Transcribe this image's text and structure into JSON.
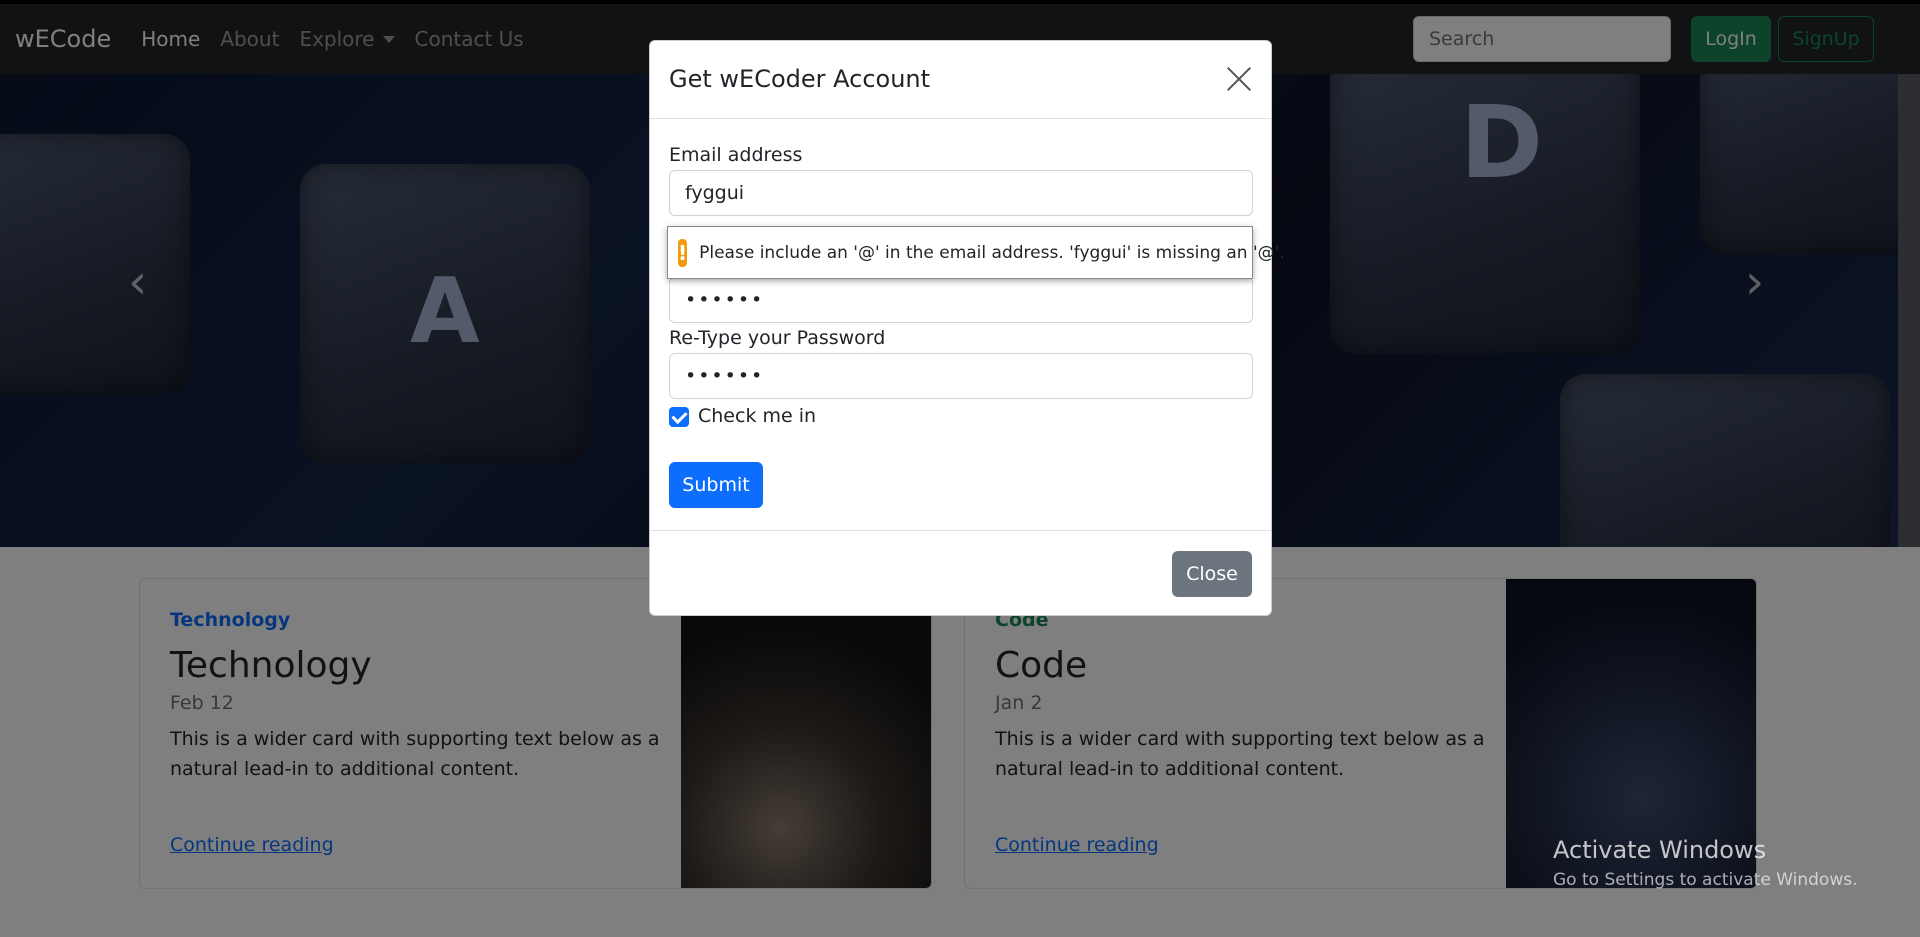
{
  "navbar": {
    "brand": "wECode",
    "links": [
      "Home",
      "About",
      "Explore",
      "Contact Us"
    ],
    "search_placeholder": "Search",
    "login_label": "LogIn",
    "signup_label": "SignUp"
  },
  "hero": {
    "prev_icon": "chevron-left-icon",
    "next_icon": "chevron-right-icon"
  },
  "cards": [
    {
      "category": "Technology",
      "category_color": "#0d6efd",
      "title": "Technology",
      "date": "Feb 12",
      "text": "This is a wider card with supporting text below as a natural lead-in to additional content.",
      "link": "Continue reading"
    },
    {
      "category": "Code",
      "category_color": "#198754",
      "title": "Code",
      "date": "Jan 2",
      "text": "This is a wider card with supporting text below as a natural lead-in to additional content.",
      "link": "Continue reading"
    }
  ],
  "modal": {
    "title": "Get wECoder Account",
    "email_label": "Email address",
    "email_value": "fyggui",
    "password_value": "••••••",
    "retype_label": "Re-Type your Password",
    "retype_value": "••••••",
    "check_label": "Check me in",
    "check_checked": true,
    "submit_label": "Submit",
    "close_label": "Close"
  },
  "validation": {
    "message": "Please include an '@' in the email address. 'fyggui' is missing an '@'.",
    "icon": "!"
  },
  "watermark": {
    "line1": "Activate Windows",
    "line2": "Go to Settings to activate Windows."
  },
  "colors": {
    "navbar_bg": "#212529",
    "success": "#198754",
    "primary": "#0d6efd",
    "secondary": "#6c757d",
    "warning": "#f29b0f"
  }
}
